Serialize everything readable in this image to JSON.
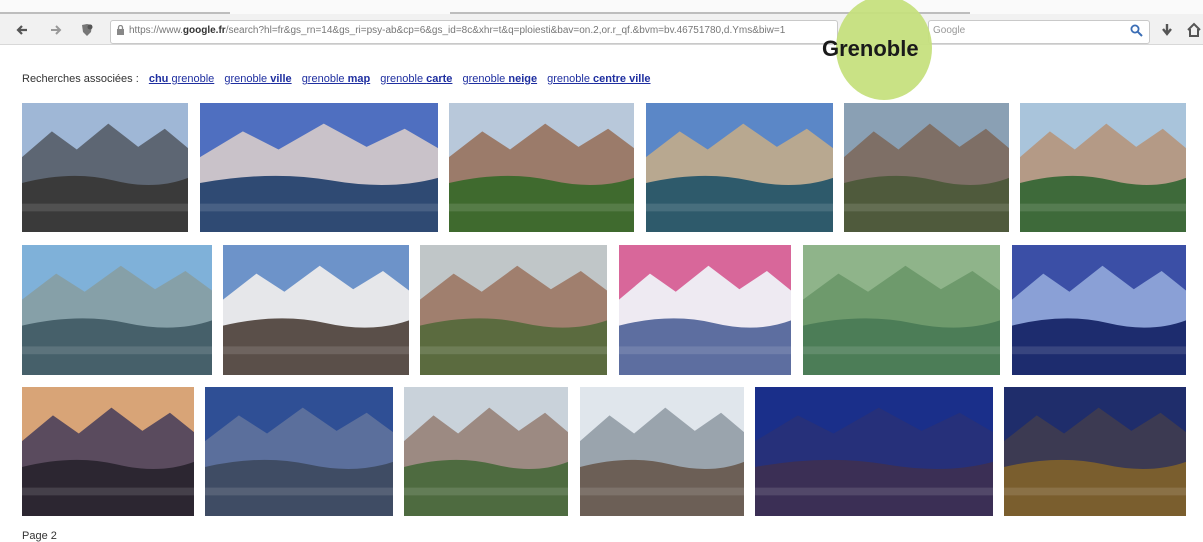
{
  "browser": {
    "url_prefix": "https://www.",
    "url_domain": "google.fr",
    "url_rest": "/search?hl=fr&gs_rn=14&gs_ri=psy-ab&cp=6&gs_id=8c&xhr=t&q=ploiesti&bav=on.2,or.r_qf.&bvm=bv.46751780,d.Yms&biw=1",
    "search_engine_label": "Google",
    "back_icon": "arrow-left-icon",
    "forward_icon": "arrow-right-icon",
    "search_icon": "magnifier-icon",
    "download_icon": "download-arrow-icon",
    "home_icon": "home-icon"
  },
  "overlay": {
    "label": "Grenoble",
    "bubble_color": "#c5e07c"
  },
  "related_searches": {
    "prefix": "Recherches associées :",
    "items": [
      {
        "normal": "",
        "bold": "chu",
        "suffix": " grenoble"
      },
      {
        "normal": "grenoble ",
        "bold": "ville",
        "suffix": ""
      },
      {
        "normal": "grenoble ",
        "bold": "map",
        "suffix": ""
      },
      {
        "normal": "grenoble ",
        "bold": "carte",
        "suffix": ""
      },
      {
        "normal": "grenoble ",
        "bold": "neige",
        "suffix": ""
      },
      {
        "normal": "grenoble ",
        "bold": "centre ville",
        "suffix": ""
      }
    ],
    "link_color": "#1f2fa0"
  },
  "images": [
    {
      "name": "aerial-city-mountains",
      "sky": "#9fb7d6",
      "mid": "#5d6673",
      "ground": "#3a3a3a"
    },
    {
      "name": "cable-car-riverside",
      "sky": "#4f6fc0",
      "mid": "#c9c2c9",
      "ground": "#2f4a73"
    },
    {
      "name": "city-panorama-green",
      "sky": "#b8c8da",
      "mid": "#9b7b6a",
      "ground": "#3f6a2e"
    },
    {
      "name": "river-cable-car-blue",
      "sky": "#5b87c7",
      "mid": "#b8a890",
      "ground": "#2e5a6b"
    },
    {
      "name": "valley-city-haze",
      "sky": "#8aa0b4",
      "mid": "#7e6f66",
      "ground": "#4f5a3c"
    },
    {
      "name": "bridge-river-summer",
      "sky": "#a9c4db",
      "mid": "#b49a86",
      "ground": "#3e6a3a"
    },
    {
      "name": "cable-cars-river-bend",
      "sky": "#7fb1d9",
      "mid": "#86a0a8",
      "ground": "#46606a"
    },
    {
      "name": "snowy-peaks-cathedral",
      "sky": "#6d93c9",
      "mid": "#e6e7ea",
      "ground": "#5a4f49"
    },
    {
      "name": "bubble-cars-rooftops",
      "sky": "#c0c6c8",
      "mid": "#a07f6e",
      "ground": "#5b6b3f"
    },
    {
      "name": "pink-sky-snow-river",
      "sky": "#d8679a",
      "mid": "#eeeaf2",
      "ground": "#5d6ea0"
    },
    {
      "name": "relief-map-green",
      "sky": "#8fb48a",
      "mid": "#6e9a6c",
      "ground": "#4c7d57"
    },
    {
      "name": "night-bridge-lights",
      "sky": "#3b4fa6",
      "mid": "#8aa0d6",
      "ground": "#1d2c6e"
    },
    {
      "name": "dusk-valley-lights",
      "sky": "#d8a477",
      "mid": "#5a4b5e",
      "ground": "#2c2631"
    },
    {
      "name": "blue-mountains-stadium",
      "sky": "#2f4f95",
      "mid": "#5b6f9c",
      "ground": "#3f4c64"
    },
    {
      "name": "cloudy-peaks-city",
      "sky": "#c9d2da",
      "mid": "#9c8a82",
      "ground": "#4e6b40"
    },
    {
      "name": "square-clouds-mountains",
      "sky": "#e0e6ec",
      "mid": "#9aa4ad",
      "ground": "#6c5f56"
    },
    {
      "name": "night-plain-lights",
      "sky": "#1a2f8a",
      "mid": "#26307a",
      "ground": "#3b2f55"
    },
    {
      "name": "night-city-grid",
      "sky": "#1f2d6b",
      "mid": "#3c3a52",
      "ground": "#7a5e2e"
    }
  ],
  "footer": {
    "page_label": "Page 2"
  }
}
